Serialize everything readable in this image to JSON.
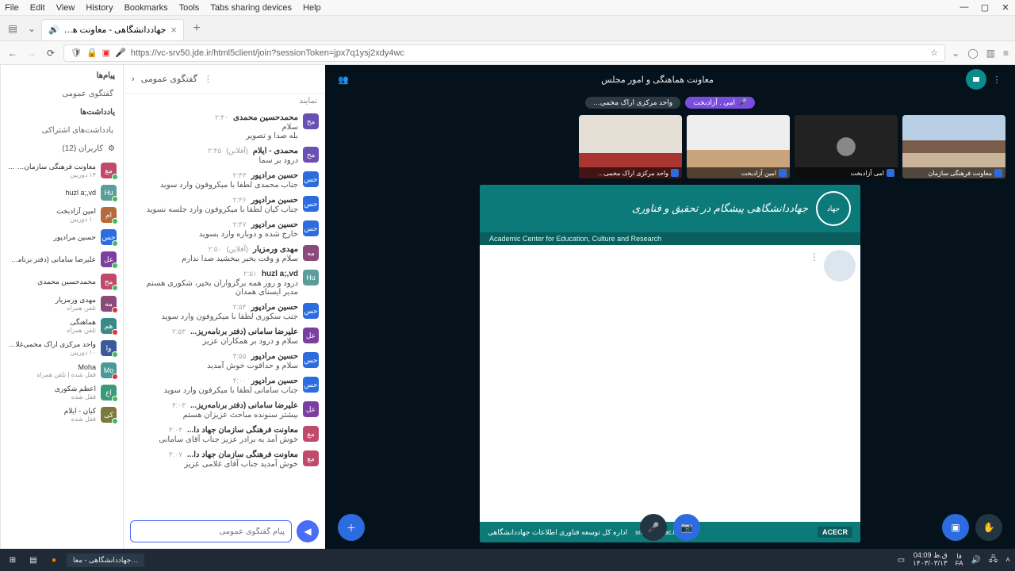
{
  "menubar": {
    "items": [
      "File",
      "Edit",
      "View",
      "History",
      "Bookmarks",
      "Tools",
      "Tabs sharing devices",
      "Help"
    ]
  },
  "tab": {
    "title": "جهاددانشگاهی - معاونت هماه",
    "sub": "PLAYING"
  },
  "url": {
    "display": "https://vc-srv50.jde.ir/html5client/join?sessionToken=jpx7q1ysj2xdy4wc"
  },
  "room": {
    "title": "معاونت هماهنگی و امور مجلس"
  },
  "banner": {
    "talking": "امی . آزادبخت",
    "listening": "واحد مرکزی اراک مخمی…"
  },
  "thumbs": [
    {
      "label": "معاونت فرهنگی سازمان"
    },
    {
      "label": "امی آزادبخت"
    },
    {
      "label": "امین آزادبخت"
    },
    {
      "label": "واحد مرکزی اراک مخمی…"
    }
  ],
  "slide": {
    "slogan": "جهاددانشگاهی پیشگام در تحقیق و فناوری",
    "sub": "Academic Center for Education, Culture and Research",
    "foot_dept": "اداره کل توسعه فناوری اطلاعات جهاددانشگاهی",
    "srm": "srm.acecr.ac.ir",
    "acecr": "ACECR"
  },
  "chat": {
    "header": "گفتگوی عمومی",
    "sub_header": "نمایند",
    "input_placeholder": "پیام گفتگوی عمومی",
    "messages": [
      {
        "avatar": "مح",
        "color": "#6a4fb5",
        "name": "محمدحسین محمدی",
        "time": "۲:۴۰",
        "text": "سلام\nبله صدا و تصویر"
      },
      {
        "avatar": "مح",
        "color": "#6a4fb5",
        "name": "محمدی - ایلام",
        "tag": "(آفلاین)",
        "time": "۲:۴۵",
        "text": "درود بر سما"
      },
      {
        "avatar": "حس",
        "color": "#2d6cdf",
        "name": "حسین مرادپور",
        "time": "۲:۴۳",
        "text": "جناب محمدی لطفا با میکروفون وارد سوید"
      },
      {
        "avatar": "حس",
        "color": "#2d6cdf",
        "name": "حسین مرادپور",
        "time": "۲:۴۶",
        "text": "جناب کیان لطفا با میکروفون وارد جلسه نسوید"
      },
      {
        "avatar": "حس",
        "color": "#2d6cdf",
        "name": "حسین مرادپور",
        "time": "۲:۴۷",
        "text": "خارج شده و دوباره وارد بسوید"
      },
      {
        "avatar": "مه",
        "color": "#8a4a7a",
        "name": "مهدی ورمزیار",
        "tag": "(آفلاین)",
        "time": "۲:۵۰",
        "text": "سلام و وقت بخیر ببخشید صدا ندارم"
      },
      {
        "avatar": "Hu",
        "color": "#5a9d9a",
        "name": "huzl a;,vd",
        "time": "۲:۵۱",
        "text": "درود و روز همه برگزواران بخیر، شکوری هستم\nمدیر ایسنای همدان"
      },
      {
        "avatar": "حس",
        "color": "#2d6cdf",
        "name": "حسین مرادپور",
        "time": "۲:۵۴",
        "text": "جنب سکوری لطفا با میکروفون وارد سوید"
      },
      {
        "avatar": "عل",
        "color": "#7a3fa0",
        "name": "علیرضا سامانی (دفتر برنامه‌ریز...",
        "time": "۲:۵۳",
        "text": "سلام و درود بر همکاران عزیز"
      },
      {
        "avatar": "حس",
        "color": "#2d6cdf",
        "name": "حسین مرادپور",
        "time": "۳:۵۵",
        "text": "سلام و حداقوت خوش آمدید"
      },
      {
        "avatar": "حس",
        "color": "#2d6cdf",
        "name": "حسین مرادپور",
        "time": "۴:۰۰",
        "text": "جناب سامانی لطفا با میکرفون وارد سوید"
      },
      {
        "avatar": "عل",
        "color": "#7a3fa0",
        "name": "علیرضا سامانی (دفتر برنامه‌ریز...",
        "time": "۴:۰۳",
        "text": "بیشتر سنونده مباحث عزیزان هستم"
      },
      {
        "avatar": "مع",
        "color": "#c04a6a",
        "name": "معاونت فرهنگی سازمان جهاد دا...",
        "time": "۴:۰۴",
        "text": "خوش آمد به برادر عزیز جناب آقای سامانی"
      },
      {
        "avatar": "مع",
        "color": "#c04a6a",
        "name": "معاونت فرهنگی سازمان جهاد دا...",
        "time": "۴:۰۷",
        "text": "خوش آمدید جناب آقای غلامی عزیز"
      }
    ]
  },
  "sidebar": {
    "messages_hdr": "پیام‌ها",
    "public_chat": "گفتگوی عمومی",
    "notes_hdr": "یادداشت‌ها",
    "shared_notes": "یادداشت‌های اشتراکی",
    "users_hdr": "کاربران (12)",
    "users": [
      {
        "avatar": "مع",
        "color": "#c04a6a",
        "name": "معاونت فرهنگی سازمان… (شما)",
        "sub": "۱۴ دوریین",
        "dot": "#3bbf5c"
      },
      {
        "avatar": "Hu",
        "color": "#5a9d9a",
        "name": "huzl a;,vd",
        "sub": "",
        "dot": "#3bbf5c"
      },
      {
        "avatar": "ام",
        "color": "#b76a3a",
        "name": "امین آزادبخت",
        "sub": "۱۰ دوریین",
        "dot": "#3bbf5c"
      },
      {
        "avatar": "حس",
        "color": "#2d6cdf",
        "name": "حسین مرادپور",
        "sub": "",
        "dot": "#3bbf5c"
      },
      {
        "avatar": "عل",
        "color": "#7a3fa0",
        "name": "علیرضا سامانی (دفتر برنامه‌ریز...",
        "sub": "",
        "dot": "#3bbf5c"
      },
      {
        "avatar": "مح",
        "color": "#c04a6a",
        "name": "محمدحسین محمدی",
        "sub": "",
        "dot": "#3bbf5c"
      },
      {
        "avatar": "مه",
        "color": "#8a4a7a",
        "name": "مهدی ورمزیار",
        "sub": "تلفن همراه",
        "dot": "#d33"
      },
      {
        "avatar": "هم",
        "color": "#3a8a8a",
        "name": "هماهنگی",
        "sub": "تلفن همراه",
        "dot": "#d33"
      },
      {
        "avatar": "وا",
        "color": "#3a5a9a",
        "name": "واحد مرکزی اراک مخمی‌غلامی",
        "sub": "۱۰ دوریین",
        "dot": "#3bbf5c"
      },
      {
        "avatar": "Mo",
        "color": "#4a9a9a",
        "name": "Moha",
        "sub": "قفل شده | تلفن همراه",
        "dot": "#d33"
      },
      {
        "avatar": "اع",
        "color": "#3a9a7a",
        "name": "اعظم شکوری",
        "sub": "قفل شده",
        "dot": "#3bbf5c"
      },
      {
        "avatar": "کی",
        "color": "#7a7a3a",
        "name": "کیان - ایلام",
        "sub": "قفل شده",
        "dot": "#3bbf5c"
      }
    ]
  },
  "taskbar": {
    "task": "…جهاددانشگاهی - معا",
    "time": "ق.ظ 04:09",
    "date": "۱۴۰۳/۰۳/۱۳",
    "lang": "فا\nFA"
  }
}
